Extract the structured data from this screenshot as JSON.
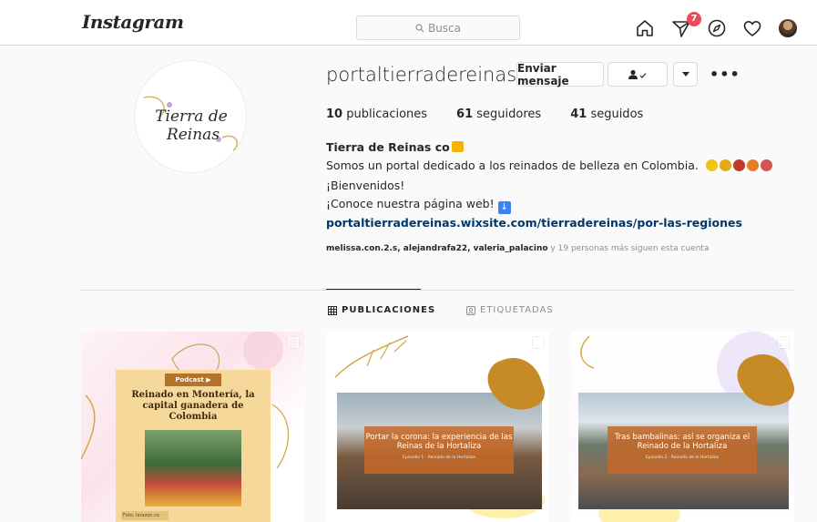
{
  "nav": {
    "logo": "Instagram",
    "search_placeholder": "Busca",
    "notifications_count": "7"
  },
  "profile": {
    "username": "portaltierradereinas",
    "message_button": "Enviar mensaje",
    "more": "•••",
    "profile_pic_text_line1": "Tierra de",
    "profile_pic_text_line2": "Reinas",
    "stats": {
      "posts_count": "10",
      "posts_label": "publicaciones",
      "followers_count": "61",
      "followers_label": "seguidores",
      "following_count": "41",
      "following_label": "seguidos"
    },
    "bio": {
      "name": "Tierra de Reinas co",
      "line1": "Somos un portal dedicado a los reinados de belleza en Colombia.",
      "line2": "¡Bienvenidos!",
      "line3": "¡Conoce nuestra página web!",
      "link": "portaltierradereinas.wixsite.com/tierradereinas/por-las-regiones"
    },
    "followed_by": {
      "users": "melissa.con.2.s, alejandrafa22, valeria_palacino",
      "rest": "y 19 personas más siguen esta cuenta"
    }
  },
  "tabs": {
    "publications": "PUBLICACIONES",
    "tagged": "ETIQUETADAS"
  },
  "posts": [
    {
      "pill": "Podcast ▶",
      "title": "Reinado en Montería, la capital ganadera de Colombia",
      "credit": "Foto: larazon.co"
    },
    {
      "title": "Portar la corona: la experiencia de las Reinas de la Hortaliza",
      "subtitle": "Episodio 1 - Reinado de la Hortaliza"
    },
    {
      "title": "Tras bambalinas: así se organiza el Reinado de la Hortaliza",
      "subtitle": "Episodio 2 - Reinado de la Hortaliza"
    }
  ],
  "colors": {
    "link": "#00376b",
    "badge": "#ed4956",
    "overlay": "#c46828",
    "accent_gold": "#c68a27"
  }
}
